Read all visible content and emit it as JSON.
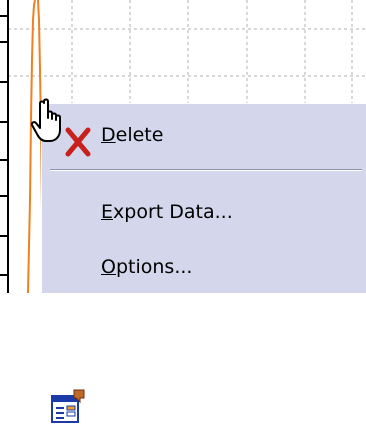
{
  "context_menu": {
    "items": [
      {
        "label_prefix": "",
        "label_accel": "D",
        "label_rest": "elete",
        "icon": "delete-x-icon"
      },
      {
        "label_prefix": "",
        "label_accel": "E",
        "label_rest": "xport Data...",
        "icon": ""
      },
      {
        "label_prefix": "",
        "label_accel": "O",
        "label_rest": "ptions...",
        "icon": "options-form-icon"
      }
    ]
  },
  "colors": {
    "menu_background": "#d4d7eb",
    "delete_icon": "#c8201c",
    "trace_line": "#f08020",
    "grid_line": "#b0b0b0",
    "axis": "#000000"
  },
  "cursor": "hand-pointer-icon"
}
